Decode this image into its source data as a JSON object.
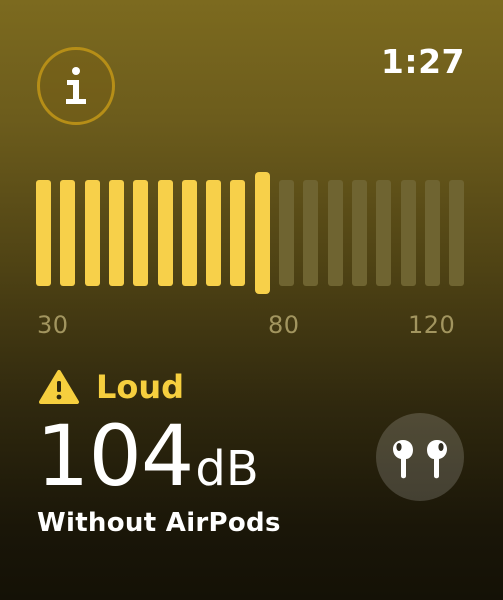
{
  "header": {
    "info_icon": "info-icon",
    "time": "1:27"
  },
  "meter": {
    "scale_min": 30,
    "scale_max": 120,
    "ticks": [
      "30",
      "80",
      "120"
    ],
    "current_level": 80,
    "colors": {
      "active": "#f7d04a",
      "inactive": "#6f6431"
    }
  },
  "status": {
    "icon": "warning-icon",
    "label": "Loud"
  },
  "reading": {
    "value": "104",
    "unit": "dB",
    "source": "Without AirPods"
  },
  "airpods_button": {
    "icon": "airpods-icon"
  },
  "colors": {
    "accent": "#f6cf3e",
    "info_ring": "#b68e17"
  }
}
